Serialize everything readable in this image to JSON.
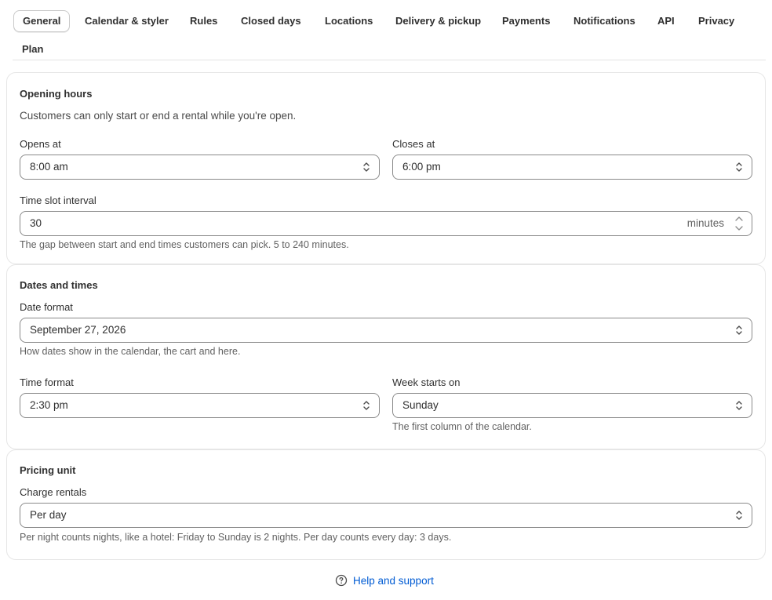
{
  "tabs": [
    {
      "label": "General",
      "active": true
    },
    {
      "label": "Calendar & styler"
    },
    {
      "label": "Rules"
    },
    {
      "label": "Closed days"
    },
    {
      "label": "Locations"
    },
    {
      "label": "Delivery & pickup"
    },
    {
      "label": "Payments"
    },
    {
      "label": "Notifications"
    },
    {
      "label": "API"
    },
    {
      "label": "Privacy"
    },
    {
      "label": "Plan"
    }
  ],
  "opening_hours": {
    "title": "Opening hours",
    "description": "Customers can only start or end a rental while you're open.",
    "opens_label": "Opens at",
    "opens_value": "8:00 am",
    "closes_label": "Closes at",
    "closes_value": "6:00 pm",
    "interval_label": "Time slot interval",
    "interval_value": "30",
    "interval_suffix": "minutes",
    "interval_help": "The gap between start and end times customers can pick. 5 to 240 minutes."
  },
  "dates_times": {
    "title": "Dates and times",
    "date_format_label": "Date format",
    "date_format_value": "September 27, 2026",
    "date_format_help": "How dates show in the calendar, the cart and here.",
    "time_format_label": "Time format",
    "time_format_value": "2:30 pm",
    "week_start_label": "Week starts on",
    "week_start_value": "Sunday",
    "week_start_help": "The first column of the calendar."
  },
  "pricing": {
    "title": "Pricing unit",
    "charge_label": "Charge rentals",
    "charge_value": "Per day",
    "charge_help": "Per night counts nights, like a hotel: Friday to Sunday is 2 nights. Per day counts every day: 3 days."
  },
  "footer": {
    "help_label": "Help and support"
  },
  "colors": {
    "link": "#005bd3",
    "border": "#8a8a8a",
    "text": "#303030"
  }
}
